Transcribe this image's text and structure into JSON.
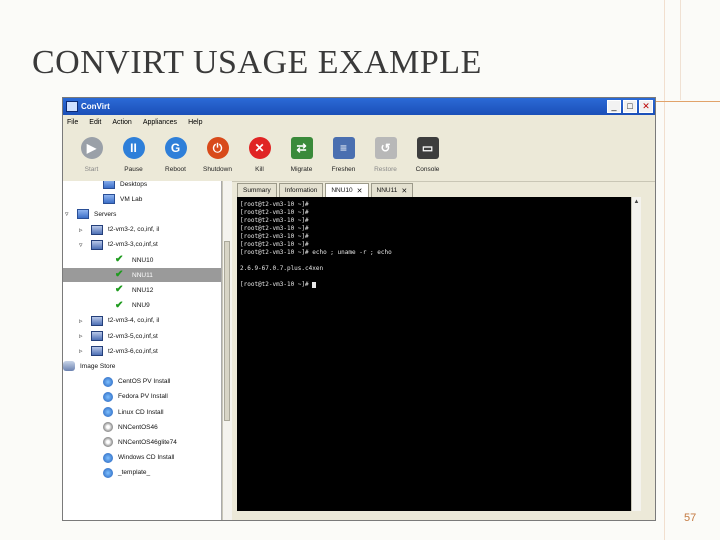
{
  "slide": {
    "title": "CONVIRT USAGE EXAMPLE",
    "page_number": "57"
  },
  "window": {
    "title": "ConVirt",
    "menu": [
      "File",
      "Edit",
      "Action",
      "Appliances",
      "Help"
    ],
    "toolbar": [
      {
        "label": "Start",
        "icon": "start-icon",
        "color": "#9aa0a8",
        "glyph": "▶",
        "enabled": false
      },
      {
        "label": "Pause",
        "icon": "pause-icon",
        "color": "#2e7fd9",
        "glyph": "II",
        "enabled": true
      },
      {
        "label": "Reboot",
        "icon": "reboot-icon",
        "color": "#2e7fd9",
        "glyph": "G",
        "enabled": true
      },
      {
        "label": "Shutdown",
        "icon": "shutdown-icon",
        "color": "#d84a1a",
        "glyph": "⏻",
        "enabled": true
      },
      {
        "label": "Kill",
        "icon": "kill-icon",
        "color": "#e02424",
        "glyph": "✕",
        "enabled": true
      },
      {
        "label": "Migrate",
        "icon": "migrate-icon",
        "color": "#3a8a3a",
        "glyph": "⇄",
        "enabled": true
      },
      {
        "label": "Freshen",
        "icon": "freshen-icon",
        "color": "#4a6fb0",
        "glyph": "≡",
        "enabled": true
      },
      {
        "label": "Restore",
        "icon": "restore-icon",
        "color": "#b8b8b8",
        "glyph": "↺",
        "enabled": false
      },
      {
        "label": "Console",
        "icon": "console-icon",
        "color": "#3d3d3d",
        "glyph": "▭",
        "enabled": true
      }
    ],
    "tree": [
      {
        "label": "Desktops",
        "indent": 40,
        "icon": "folder",
        "expander": ""
      },
      {
        "label": "VM Lab",
        "indent": 40,
        "icon": "folder",
        "expander": ""
      },
      {
        "label": "Servers",
        "indent": 14,
        "icon": "folder",
        "expander": "▿"
      },
      {
        "label": "t2-vm3-2, co,inf, il",
        "indent": 28,
        "icon": "server",
        "expander": "▹"
      },
      {
        "label": "t2-vm3-3,co,inf,st",
        "indent": 28,
        "icon": "server",
        "expander": "▿"
      },
      {
        "label": "NNU10",
        "indent": 52,
        "icon": "check",
        "expander": ""
      },
      {
        "label": "NNU11",
        "indent": 52,
        "icon": "check",
        "expander": "",
        "selected": true
      },
      {
        "label": "NNU12",
        "indent": 52,
        "icon": "check",
        "expander": ""
      },
      {
        "label": "NNU9",
        "indent": 52,
        "icon": "check",
        "expander": ""
      },
      {
        "label": "t2-vm3-4, co,inf, il",
        "indent": 28,
        "icon": "server",
        "expander": "▹"
      },
      {
        "label": "t2-vm3-5,co,inf,st",
        "indent": 28,
        "icon": "server",
        "expander": "▹"
      },
      {
        "label": "t2-vm3-6,co,inf,st",
        "indent": 28,
        "icon": "server",
        "expander": "▹"
      },
      {
        "label": "Image Store",
        "indent": 0,
        "icon": "store",
        "expander": "▿"
      },
      {
        "label": "CentOS PV Install",
        "indent": 40,
        "icon": "image",
        "expander": ""
      },
      {
        "label": "Fedora PV Install",
        "indent": 40,
        "icon": "image",
        "expander": ""
      },
      {
        "label": "Linux CD Install",
        "indent": 40,
        "icon": "image",
        "expander": ""
      },
      {
        "label": "NNCentOS46",
        "indent": 40,
        "icon": "cd",
        "expander": ""
      },
      {
        "label": "NNCentOS46glite74",
        "indent": 40,
        "icon": "cd",
        "expander": ""
      },
      {
        "label": "Windows CD Install",
        "indent": 40,
        "icon": "image",
        "expander": ""
      },
      {
        "label": "_template_",
        "indent": 40,
        "icon": "image",
        "expander": ""
      }
    ],
    "tabs": [
      {
        "label": "Summary",
        "active": false,
        "closable": false
      },
      {
        "label": "Information",
        "active": false,
        "closable": false
      },
      {
        "label": "NNU10",
        "active": true,
        "closable": true
      },
      {
        "label": "NNU11",
        "active": false,
        "closable": true
      }
    ],
    "console_lines": [
      "[root@t2-vm3-10 ~]#",
      "[root@t2-vm3-10 ~]#",
      "[root@t2-vm3-10 ~]#",
      "[root@t2-vm3-10 ~]#",
      "[root@t2-vm3-10 ~]#",
      "[root@t2-vm3-10 ~]#",
      "[root@t2-vm3-10 ~]# echo ; uname -r ; echo",
      "",
      "2.6.9-67.0.7.plus.c4xen",
      "",
      "[root@t2-vm3-10 ~]# "
    ]
  }
}
